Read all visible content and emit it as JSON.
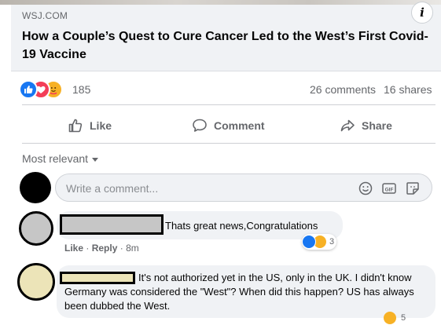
{
  "link_preview": {
    "domain": "WSJ.COM",
    "headline": "How a Couple’s Quest to Cure Cancer Led to the West’s First Covid-19 Vaccine",
    "info_icon": "info-icon"
  },
  "stats": {
    "reaction_icons": [
      "like-reaction-icon",
      "love-reaction-icon",
      "care-reaction-icon"
    ],
    "reaction_count": "185",
    "comments": "26 comments",
    "shares": "16 shares"
  },
  "actions": {
    "like_label": "Like",
    "comment_label": "Comment",
    "share_label": "Share"
  },
  "sort": {
    "label": "Most relevant"
  },
  "composer": {
    "placeholder": "Write a comment..."
  },
  "comments": [
    {
      "text": "Thats great news,Congratulations",
      "like_label": "Like",
      "reply_label": "Reply",
      "time": "8m",
      "reaction_count": "3"
    },
    {
      "text": "It's not authorized yet in the US, only in the UK. I didn't know Germany was considered the \"West\"? When did this happen? US has always been dubbed the West.",
      "reaction_count": "5"
    }
  ],
  "colors": {
    "accent_blue": "#1877f2",
    "love_red": "#f33e58",
    "haha_yellow": "#f7b125",
    "secondary_text": "#65676b",
    "bubble_bg": "#f0f2f5"
  }
}
